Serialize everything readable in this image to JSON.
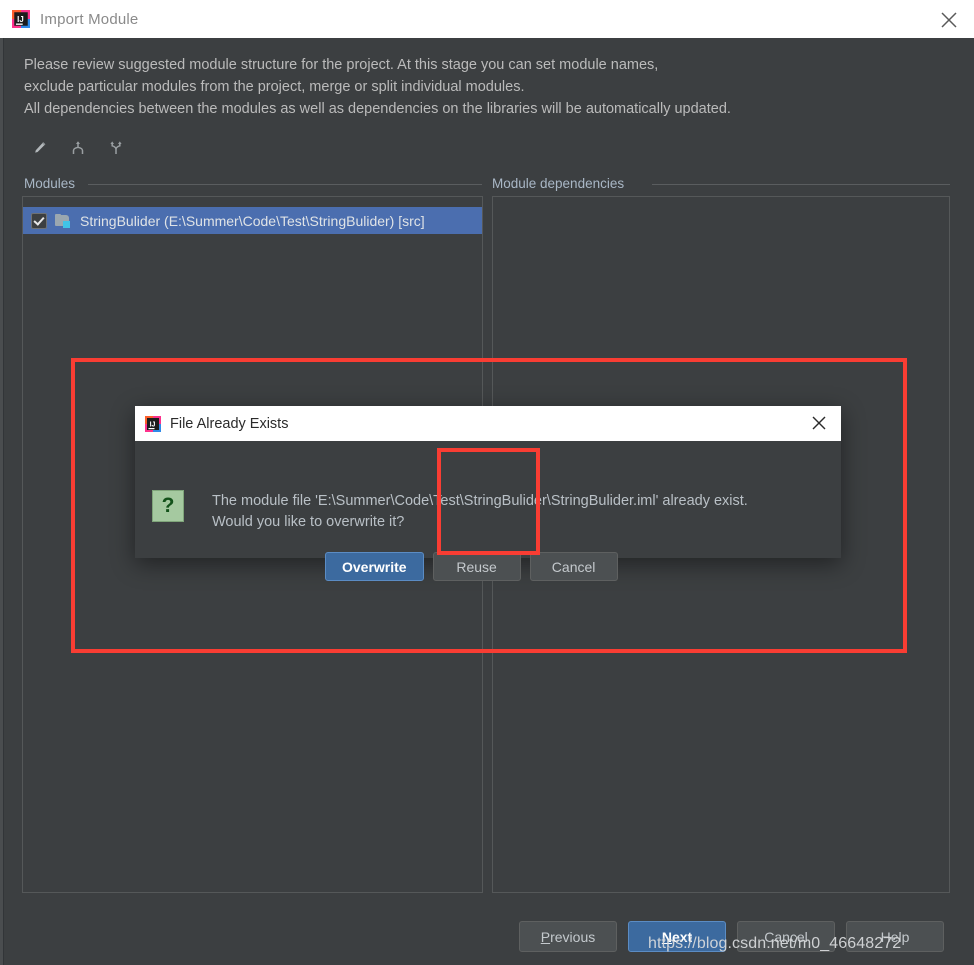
{
  "window": {
    "title": "Import Module",
    "app_icon": "intellij-idea-icon",
    "close_icon": "close-icon"
  },
  "description": {
    "line1": "Please review suggested module structure for the project. At this stage you can set module names,",
    "line2": "exclude particular modules from the project, merge or split individual modules.",
    "line3": "All dependencies between the modules as well as dependencies on the libraries will be automatically updated."
  },
  "toolbar": {
    "buttons": [
      {
        "name": "edit-pencil-icon",
        "tooltip": "Edit"
      },
      {
        "name": "merge-modules-icon",
        "tooltip": "Merge"
      },
      {
        "name": "split-module-icon",
        "tooltip": "Split"
      }
    ]
  },
  "panels": {
    "modules_label": "Modules",
    "dependencies_label": "Module dependencies"
  },
  "modules": {
    "items": [
      {
        "checked": true,
        "label": "StringBulider (E:\\Summer\\Code\\Test\\StringBulider) [src]",
        "selected": true
      }
    ]
  },
  "dependencies": {
    "items": []
  },
  "dialog": {
    "title": "File Already Exists",
    "app_icon": "intellij-idea-icon",
    "close_icon": "close-icon",
    "status_icon": "question-icon",
    "message_line1": "The module file 'E:\\Summer\\Code\\Test\\StringBulider\\StringBulider.iml' already exist.",
    "message_line2": "Would you like to overwrite it?",
    "buttons": {
      "overwrite": "Overwrite",
      "reuse": "Reuse",
      "cancel": "Cancel"
    }
  },
  "wizard": {
    "previous": "Previous",
    "previous_mnemonic": "P",
    "next": "Next",
    "next_mnemonic": "N",
    "cancel": "Cancel",
    "help": "Help"
  },
  "annotations": {
    "outer_highlight": "red-rectangle-around-dialog",
    "inner_highlight": "red-rectangle-around-reuse-button"
  },
  "watermark": {
    "text": "https://blog.csdn.net/m0_46648272"
  },
  "colors": {
    "background": "#3c3f41",
    "titlebar": "#ffffff",
    "selection": "#4b6eaf",
    "primary_button": "#3c6a9f",
    "annotation_red": "#f93d33",
    "question_green": "#a5c9a0"
  }
}
